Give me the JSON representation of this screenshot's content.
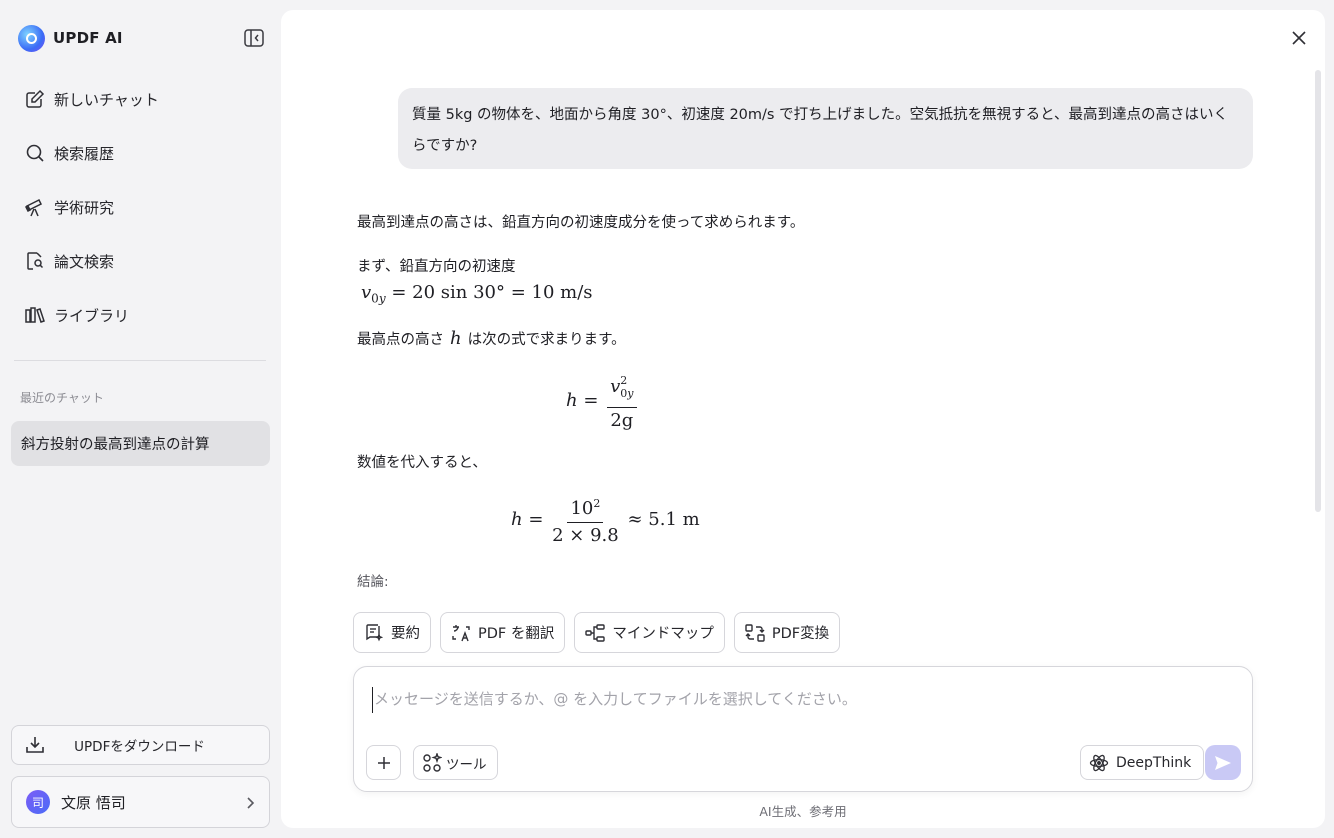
{
  "app": {
    "name": "UPDF AI",
    "brand_color": "#3b6cf6",
    "accent_color": "#c9c9f5"
  },
  "sidebar": {
    "collapse_icon": "sidebar-collapse-icon",
    "nav": [
      {
        "label": "新しいチャット",
        "icon": "new-chat-icon"
      },
      {
        "label": "検索履歴",
        "icon": "search-icon"
      },
      {
        "label": "学術研究",
        "icon": "telescope-icon"
      },
      {
        "label": "論文検索",
        "icon": "document-search-icon"
      },
      {
        "label": "ライブラリ",
        "icon": "library-icon"
      }
    ],
    "recent_label": "最近のチャット",
    "recent_chats": [
      {
        "title": "斜方投射の最高到達点の計算",
        "active": true
      }
    ],
    "download_label": "UPDFをダウンロード",
    "user": {
      "avatar_char": "司",
      "name": "文原 悟司"
    }
  },
  "chat": {
    "user_message": "質量 5kg の物体を、地面から角度 30°、初速度 20m/s で打ち上げました。空気抵抗を無視すると、最高到達点の高さはいくらですか?",
    "answer": {
      "intro": "最高到達点の高さは、鉛直方向の初速度成分を使って求められます。",
      "step1": "まず、鉛直方向の初速度",
      "eq1_rhs": "= 20 sin 30° = 10 m/s",
      "step2_pre": "最高点の高さ",
      "step2_var": "h",
      "step2_post": "は次の式で求まります。",
      "eq2_den": "2g",
      "step3": "数値を代入すると、",
      "eq3_num": "10",
      "eq3_num_exp": "2",
      "eq3_den": "2 × 9.8",
      "eq3_result": "≈ 5.1 m",
      "conclusion": "結論:"
    }
  },
  "quick_actions": [
    {
      "label": "要約",
      "icon": "summary-icon"
    },
    {
      "label": "PDF を翻訳",
      "icon": "translate-icon"
    },
    {
      "label": "マインドマップ",
      "icon": "mindmap-icon"
    },
    {
      "label": "PDF変換",
      "icon": "convert-icon"
    }
  ],
  "composer": {
    "placeholder": "メッセージを送信するか、@ を入力してファイルを選択してください。",
    "tools_label": "ツール",
    "deepthink_label": "DeepThink"
  },
  "footer": {
    "disclaimer": "AI生成、参考用"
  }
}
